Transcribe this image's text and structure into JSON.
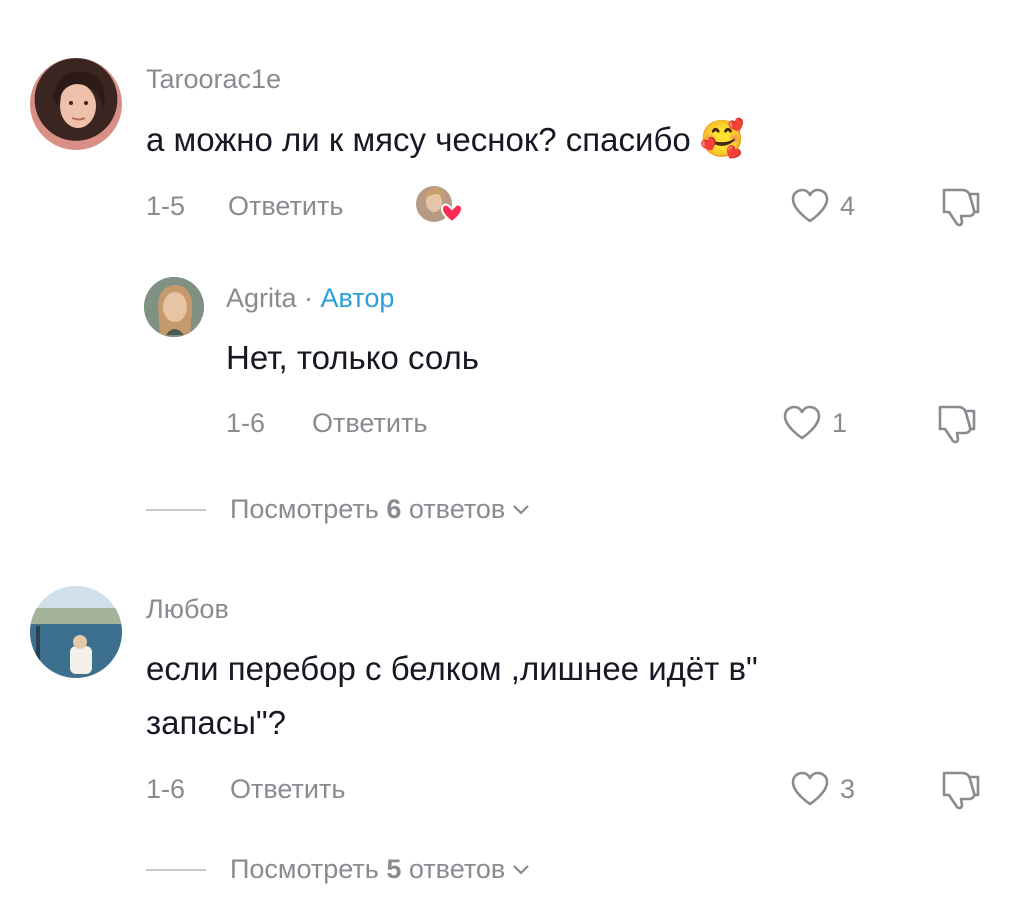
{
  "comments": [
    {
      "username": "Taroorac1e",
      "text": "а можно ли к мясу чеснок? спасибо",
      "emoji": "🥰",
      "date": "1-5",
      "reply_label": "Ответить",
      "likes": "4"
    },
    {
      "username": "Agrita",
      "separator": " · ",
      "author_badge": "Автор",
      "text": "Нет, только соль",
      "date": "1-6",
      "reply_label": "Ответить",
      "likes": "1",
      "view_prefix": "Посмотреть ",
      "view_count": "6",
      "view_suffix": " ответов"
    },
    {
      "username": "Любов",
      "text_line1": "если перебор с белком ,лишнее идёт в\"",
      "text_line2": "запасы\"?",
      "date": "1-6",
      "reply_label": "Ответить",
      "likes": "3",
      "view_prefix": "Посмотреть ",
      "view_count": "5",
      "view_suffix": " ответов"
    }
  ],
  "icons": [
    "heart-outline-icon",
    "thumbs-down-icon",
    "chevron-down-icon",
    "liked-by-creator-icon"
  ],
  "colors": {
    "text": "#161823",
    "secondary": "#8a8b91",
    "author": "#2aa0dc",
    "like_heart": "#fe2c55"
  }
}
